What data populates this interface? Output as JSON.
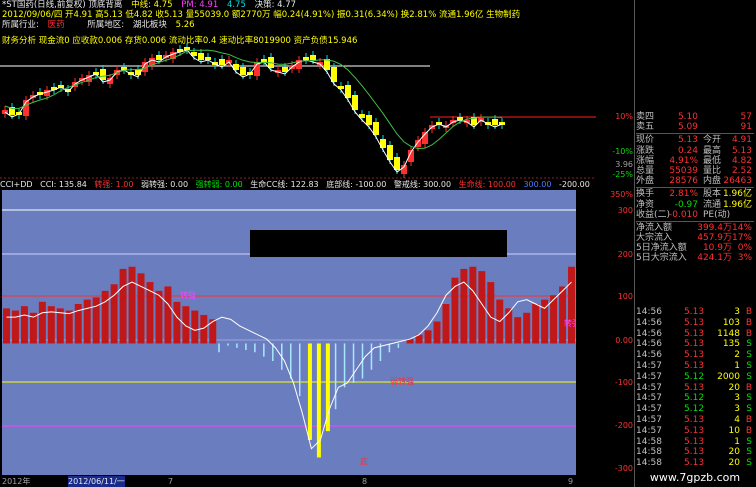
{
  "header": {
    "title_line": "*ST国药(日线,前复权) 顶底背离",
    "mid_label": "中线: 4.75",
    "pm_label": "PM: 4.91",
    "val1": "4.75",
    "decision": "决策: 4.77",
    "line2": "2012/09/06/四 开4.91 高5.13 低4.82 收5.13 量55039.0 额2770万 幅0.24(4.91%) 振0.31(6.34%) 换2.81% 流通1.96亿 生物制药",
    "industry_label": "所属行业:",
    "industry_value": "医药",
    "region_label": "所属地区:",
    "region_value": "湖北板块",
    "region_num": "5.26",
    "finance_line": "财务分析 现金流0    应收款0.006 存货0.006 流动比率0.4 速动比率8019900    资产负债15.946"
  },
  "price_axis": {
    "pct_top": "10%",
    "pct_bottom": "-10%",
    "p1": "3.96",
    "p2": "-25%"
  },
  "indicator": {
    "header_parts": {
      "name": "CCI+DD",
      "cci": "CCI: 135.84",
      "zhuan": "转强: 1.00",
      "weak": "弱转强: 0.00",
      "strong": "强转弱: 0.00",
      "life": "生命CC线: 122.83",
      "bottom": "底部线: -100.00",
      "alert": "警戒线: 300.00",
      "life2": "生命线: 100.00",
      "v300": "300.00",
      "vm200": "-200.00"
    },
    "axis": [
      "350%",
      "300",
      "200",
      "100",
      "0.00",
      "-100",
      "-200",
      "-300"
    ],
    "labels": {
      "zq": "转强",
      "rz": "弱转强",
      "dz": "底"
    }
  },
  "time_axis": [
    "2012年",
    "2012/06/11/一",
    "7",
    "8",
    "9"
  ],
  "quote": {
    "rows": [
      {
        "k": "卖四",
        "v": "5.10",
        "k2": "",
        "v2": "57"
      },
      {
        "k": "卖五",
        "v": "5.09",
        "k2": "",
        "v2": "91"
      },
      {
        "k": "现价",
        "v": "5.13",
        "k2": "今开",
        "v2": "4.91"
      },
      {
        "k": "涨跌",
        "v": "0.24",
        "k2": "最高",
        "v2": "5.13"
      },
      {
        "k": "涨幅",
        "v": "4.91%",
        "k2": "最低",
        "v2": "4.82"
      },
      {
        "k": "总量",
        "v": "55039",
        "k2": "量比",
        "v2": "2.52"
      },
      {
        "k": "外盘",
        "v": "28576",
        "k2": "内盘",
        "v2": "26463"
      },
      {
        "k": "换手",
        "v": "2.81%",
        "k2": "股本",
        "v2": "1.96亿"
      },
      {
        "k": "净资",
        "v": "-0.97",
        "k2": "流通",
        "v2": "1.96亿"
      },
      {
        "k": "收益(二)",
        "v": "-0.010",
        "k2": "PE(动)",
        "v2": ""
      }
    ],
    "flows": [
      {
        "k": "净流入额",
        "v": "399.4万",
        "p": "14%"
      },
      {
        "k": "大宗流入",
        "v": "457.9万",
        "p": "17%"
      },
      {
        "k": "5日净流入额",
        "v": "10.9万",
        "p": "0%"
      },
      {
        "k": "5日大宗流入",
        "v": "424.1万",
        "p": "3%"
      }
    ]
  },
  "trades": [
    {
      "t": "14:56",
      "p": "5.13",
      "v": "3",
      "bs": "B"
    },
    {
      "t": "14:56",
      "p": "5.13",
      "v": "103",
      "bs": "B"
    },
    {
      "t": "14:56",
      "p": "5.13",
      "v": "1148",
      "bs": "B"
    },
    {
      "t": "14:56",
      "p": "5.13",
      "v": "135",
      "bs": "S"
    },
    {
      "t": "14:56",
      "p": "5.13",
      "v": "2",
      "bs": "S"
    },
    {
      "t": "14:57",
      "p": "5.13",
      "v": "1",
      "bs": "S"
    },
    {
      "t": "14:57",
      "p": "5.12",
      "v": "2000",
      "bs": "S"
    },
    {
      "t": "14:57",
      "p": "5.13",
      "v": "20",
      "bs": "B"
    },
    {
      "t": "14:57",
      "p": "5.12",
      "v": "3",
      "bs": "S"
    },
    {
      "t": "14:57",
      "p": "5.12",
      "v": "3",
      "bs": "S"
    },
    {
      "t": "14:57",
      "p": "5.13",
      "v": "4",
      "bs": "B"
    },
    {
      "t": "14:57",
      "p": "5.13",
      "v": "10",
      "bs": "B"
    },
    {
      "t": "14:58",
      "p": "5.13",
      "v": "1",
      "bs": "S"
    },
    {
      "t": "14:58",
      "p": "5.13",
      "v": "20",
      "bs": "S"
    },
    {
      "t": "14:58",
      "p": "5.13",
      "v": "20",
      "bs": "S"
    }
  ],
  "watermark": "www.7gpzb.com",
  "colors": {
    "up": "#ff3030",
    "down": "#ffff00",
    "panel": "#6a7dbf",
    "buy": "#ff3030",
    "sell": "#00e000"
  },
  "chart_data": {
    "type": "bar",
    "series": [
      {
        "name": "CCI",
        "values": [
          80,
          75,
          85,
          70,
          95,
          85,
          80,
          75,
          90,
          100,
          105,
          120,
          135,
          170,
          175,
          160,
          140,
          120,
          130,
          95,
          85,
          75,
          65,
          55,
          -20,
          -5,
          -10,
          -15,
          -20,
          -30,
          -40,
          -60,
          -80,
          -120,
          -220,
          -260,
          -200,
          -150,
          -100,
          -90,
          -80,
          -60,
          -40,
          -20,
          -10,
          10,
          20,
          30,
          50,
          90,
          150,
          170,
          175,
          165,
          140,
          100,
          80,
          60,
          70,
          90,
          100,
          110,
          130,
          175
        ]
      },
      {
        "name": "生命CC线",
        "values": [
          60,
          60,
          65,
          60,
          70,
          72,
          70,
          68,
          75,
          80,
          85,
          95,
          110,
          130,
          140,
          130,
          120,
          110,
          90,
          60,
          40,
          30,
          35,
          50,
          60,
          55,
          40,
          30,
          20,
          10,
          -10,
          -40,
          -90,
          -160,
          -240,
          -220,
          -150,
          -100,
          -90,
          -60,
          -30,
          -10,
          -5,
          0,
          5,
          10,
          20,
          40,
          70,
          110,
          130,
          140,
          120,
          90,
          60,
          50,
          70,
          95,
          100,
          90,
          80,
          100,
          120,
          140
        ]
      }
    ],
    "ylim": [
      -300,
      350
    ]
  }
}
